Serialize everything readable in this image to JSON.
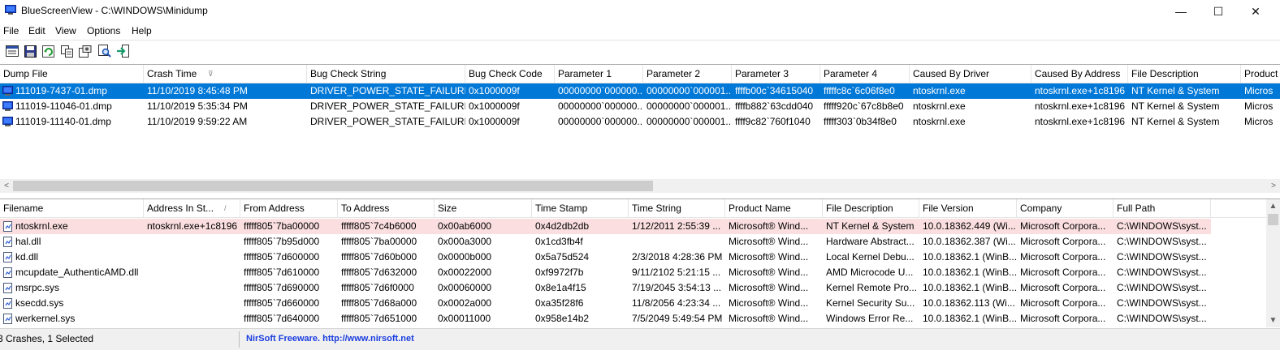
{
  "window": {
    "title": "BlueScreenView  -  C:\\WINDOWS\\Minidump",
    "minimize_symbol": "—",
    "maximize_symbol": "☐",
    "close_symbol": "✕"
  },
  "menu": [
    "File",
    "Edit",
    "View",
    "Options",
    "Help"
  ],
  "toolbar_icons": [
    "properties-icon",
    "save-icon",
    "refresh-icon",
    "copy-icon",
    "advanced-options-icon",
    "find-icon",
    "exit-icon"
  ],
  "colors": {
    "selection": "#0078d7",
    "highlight_row": "#fbdfe0",
    "link": "#1a3de0"
  },
  "crash_table": {
    "columns": [
      "Dump File",
      "Crash Time",
      "Bug Check String",
      "Bug Check Code",
      "Parameter 1",
      "Parameter 2",
      "Parameter 3",
      "Parameter 4",
      "Caused By Driver",
      "Caused By Address",
      "File Description",
      "Product"
    ],
    "sort_indicator": "⊽",
    "rows": [
      [
        "111019-7437-01.dmp",
        "11/10/2019 8:45:48 PM",
        "DRIVER_POWER_STATE_FAILURE",
        "0x1000009f",
        "00000000`000000...",
        "00000000`000001...",
        "ffffb00c`34615040",
        "fffffc8c`6c06f8e0",
        "ntoskrnl.exe",
        "ntoskrnl.exe+1c8196",
        "NT Kernel & System",
        "Micros"
      ],
      [
        "111019-11046-01.dmp",
        "11/10/2019 5:35:34 PM",
        "DRIVER_POWER_STATE_FAILURE",
        "0x1000009f",
        "00000000`000000...",
        "00000000`000001...",
        "ffffb882`63cdd040",
        "fffff920c`67c8b8e0",
        "ntoskrnl.exe",
        "ntoskrnl.exe+1c8196",
        "NT Kernel & System",
        "Micros"
      ],
      [
        "111019-11140-01.dmp",
        "11/10/2019 9:59:22 AM",
        "DRIVER_POWER_STATE_FAILURE",
        "0x1000009f",
        "00000000`000000...",
        "00000000`000001...",
        "ffff9c82`760f1040",
        "fffff303`0b34f8e0",
        "ntoskrnl.exe",
        "ntoskrnl.exe+1c8196",
        "NT Kernel & System",
        "Micros"
      ]
    ],
    "selected_index": 0,
    "scroll_left_symbol": "<",
    "scroll_right_symbol": ">"
  },
  "driver_table": {
    "columns": [
      "Filename",
      "Address In St...",
      "From Address",
      "To Address",
      "Size",
      "Time Stamp",
      "Time String",
      "Product Name",
      "File Description",
      "File Version",
      "Company",
      "Full Path"
    ],
    "sort_indicator": "/",
    "rows": [
      [
        "ntoskrnl.exe",
        "ntoskrnl.exe+1c8196",
        "fffff805`7ba00000",
        "fffff805`7c4b6000",
        "0x00ab6000",
        "0x4d2db2db",
        "1/12/2011 2:55:39 ...",
        "Microsoft® Wind...",
        "NT Kernel & System",
        "10.0.18362.449 (Wi...",
        "Microsoft Corpora...",
        "C:\\WINDOWS\\syst..."
      ],
      [
        "hal.dll",
        "",
        "fffff805`7b95d000",
        "fffff805`7ba00000",
        "0x000a3000",
        "0x1cd3fb4f",
        "",
        "Microsoft® Wind...",
        "Hardware Abstract...",
        "10.0.18362.387 (Wi...",
        "Microsoft Corpora...",
        "C:\\WINDOWS\\syst..."
      ],
      [
        "kd.dll",
        "",
        "fffff805`7d600000",
        "fffff805`7d60b000",
        "0x0000b000",
        "0x5a75d524",
        "2/3/2018 4:28:36 PM",
        "Microsoft® Wind...",
        "Local Kernel Debu...",
        "10.0.18362.1 (WinB...",
        "Microsoft Corpora...",
        "C:\\WINDOWS\\syst..."
      ],
      [
        "mcupdate_AuthenticAMD.dll",
        "",
        "fffff805`7d610000",
        "fffff805`7d632000",
        "0x00022000",
        "0xf9972f7b",
        "9/11/2102 5:21:15 ...",
        "Microsoft® Wind...",
        "AMD Microcode U...",
        "10.0.18362.1 (WinB...",
        "Microsoft Corpora...",
        "C:\\WINDOWS\\syst..."
      ],
      [
        "msrpc.sys",
        "",
        "fffff805`7d690000",
        "fffff805`7d6f0000",
        "0x00060000",
        "0x8e1a4f15",
        "7/19/2045 3:54:13 ...",
        "Microsoft® Wind...",
        "Kernel Remote Pro...",
        "10.0.18362.1 (WinB...",
        "Microsoft Corpora...",
        "C:\\WINDOWS\\syst..."
      ],
      [
        "ksecdd.sys",
        "",
        "fffff805`7d660000",
        "fffff805`7d68a000",
        "0x0002a000",
        "0xa35f28f6",
        "11/8/2056 4:23:34 ...",
        "Microsoft® Wind...",
        "Kernel Security Su...",
        "10.0.18362.113 (Wi...",
        "Microsoft Corpora...",
        "C:\\WINDOWS\\syst..."
      ],
      [
        "werkernel.sys",
        "",
        "fffff805`7d640000",
        "fffff805`7d651000",
        "0x00011000",
        "0x958e14b2",
        "7/5/2049 5:49:54 PM",
        "Microsoft® Wind...",
        "Windows Error Re...",
        "10.0.18362.1 (WinB...",
        "Microsoft Corpora...",
        "C:\\WINDOWS\\syst..."
      ]
    ],
    "highlighted_index": 0,
    "scroll_up_symbol": "▲",
    "scroll_down_symbol": "▼"
  },
  "status": {
    "summary": "3 Crashes, 1 Selected",
    "credit": "NirSoft Freeware.  http://www.nirsoft.net"
  }
}
